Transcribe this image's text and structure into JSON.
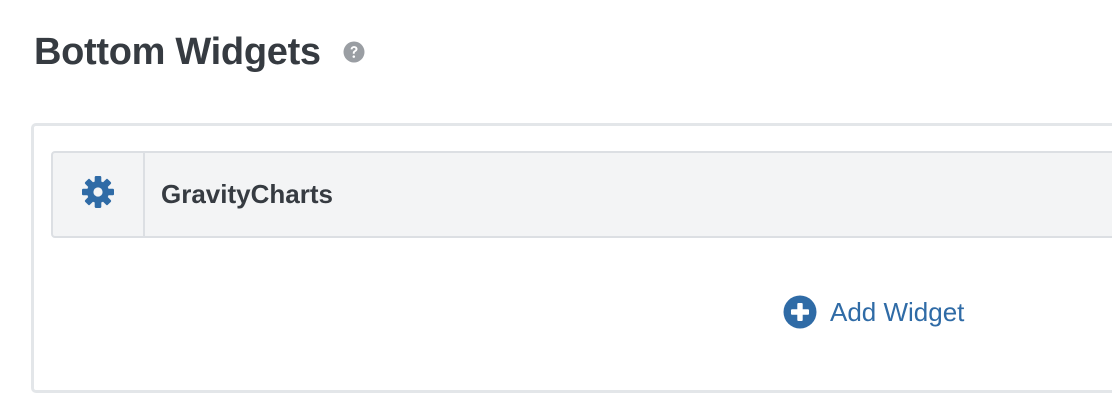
{
  "section": {
    "title": "Bottom Widgets",
    "help_icon": "question-circle-icon"
  },
  "widgets": [
    {
      "name": "GravityCharts",
      "settings_icon": "gear-icon"
    }
  ],
  "add_widget": {
    "label": "Add Widget",
    "icon": "plus-circle-icon"
  },
  "colors": {
    "title_text": "#363b41",
    "accent": "#2f6ba6",
    "help_icon": "#9a9ea3",
    "row_background": "#f3f4f5",
    "border": "#dcdfe3"
  }
}
